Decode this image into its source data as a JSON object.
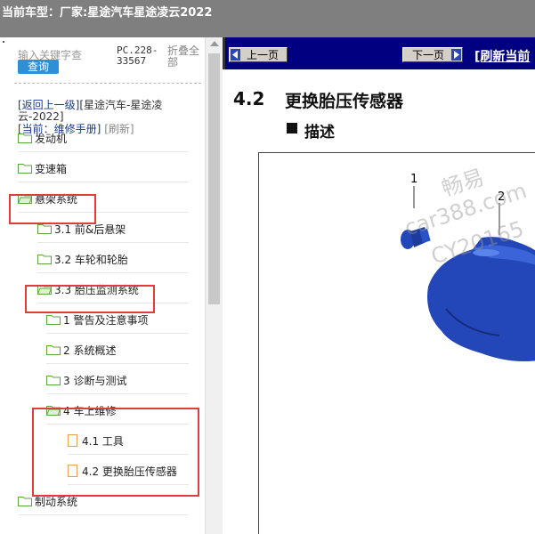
{
  "window": {
    "title": "当前车型：厂家:星途汽车星途凌云2022"
  },
  "search": {
    "placeholder": "输入关键字查",
    "query_label": "查询",
    "model_no": "PC.228-33567",
    "collapse_label": "折叠全部"
  },
  "nav": {
    "back_label": "[返回上一级]",
    "breadcrumb": "[星途汽车-星途凌云-2022]",
    "current_label": "[当前：维修手册]",
    "refresh_label": "[刷新]"
  },
  "tree": [
    {
      "label": "发动机",
      "icon": "folder-icon"
    },
    {
      "label": "变速箱",
      "icon": "folder-icon"
    },
    {
      "label": "悬架系统",
      "icon": "folder-open-icon"
    },
    {
      "label": "3.1 前&后悬架",
      "icon": "folder-icon"
    },
    {
      "label": "3.2 车轮和轮胎",
      "icon": "folder-icon"
    },
    {
      "label": "3.3 胎压监测系统",
      "icon": "folder-open-icon"
    },
    {
      "label": "1 警告及注意事项",
      "icon": "folder-icon"
    },
    {
      "label": "2 系统概述",
      "icon": "folder-icon"
    },
    {
      "label": "3 诊断与测试",
      "icon": "folder-icon"
    },
    {
      "label": "4 车上维修",
      "icon": "folder-open-icon"
    },
    {
      "label": "4.1 工具",
      "icon": "document-icon"
    },
    {
      "label": "4.2 更换胎压传感器",
      "icon": "document-icon"
    },
    {
      "label": "制动系统",
      "icon": "folder-icon"
    }
  ],
  "content": {
    "prev_label": "上一页",
    "next_label": "下一页",
    "refresh_label": "[刷新当前",
    "section_number": "4.2",
    "section_title": "更换胎压传感器",
    "desc_title": "描述",
    "callout_1": "1",
    "callout_2": "2",
    "watermark_1": "畅易",
    "watermark_2": "car388.com",
    "watermark_3": "CY20165"
  },
  "colors": {
    "highlight": "#e23b3b",
    "toolbar_bg": "#000080",
    "folder": "#5aa83a",
    "part": "#2346b8"
  }
}
